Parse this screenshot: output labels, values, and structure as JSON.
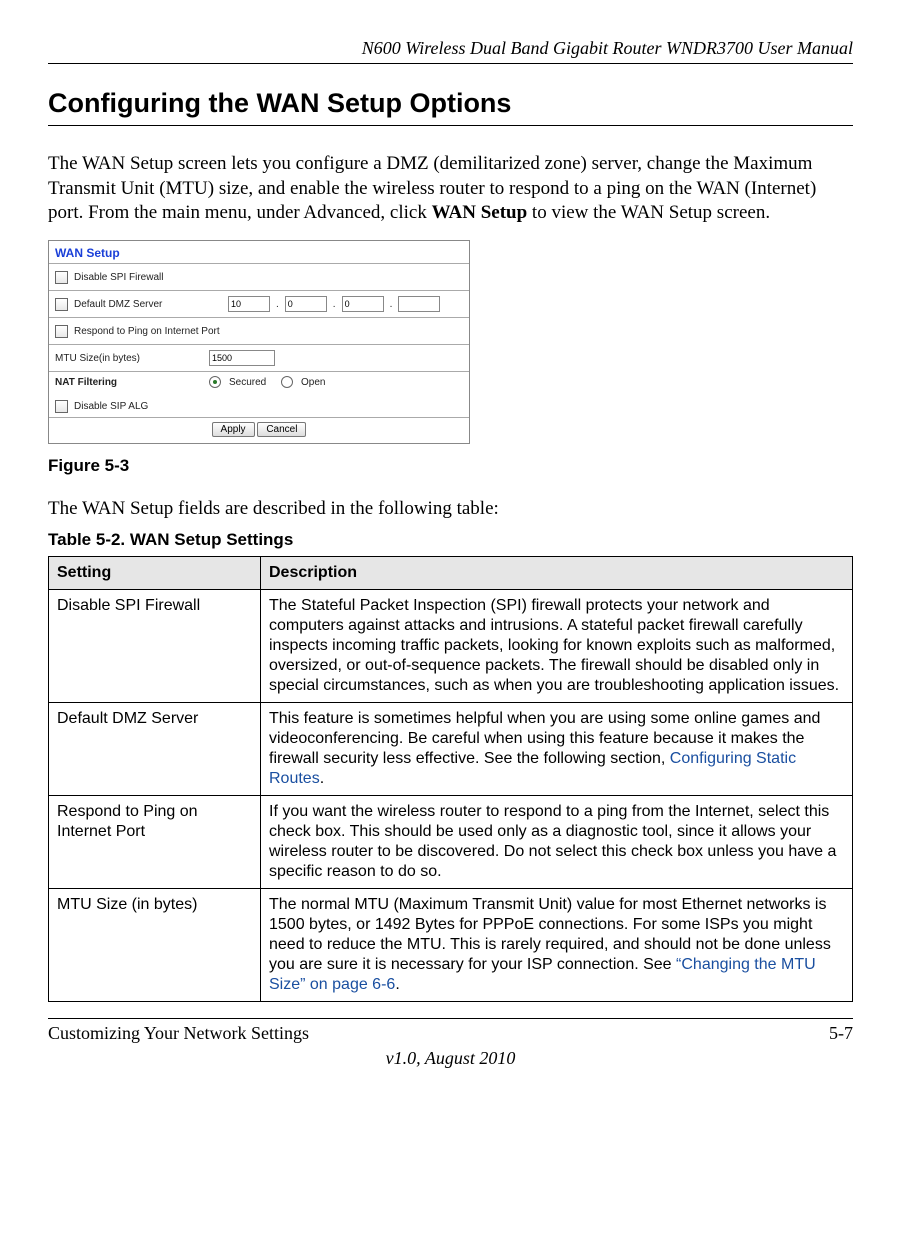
{
  "header": {
    "product_title": "N600 Wireless Dual Band Gigabit Router WNDR3700 User Manual"
  },
  "section": {
    "title": "Configuring the WAN Setup Options",
    "intro_part1": "The WAN Setup screen lets you configure a DMZ (demilitarized zone) server, change the Maximum Transmit Unit (MTU) size, and enable the wireless router to respond to a ping on the WAN (Internet) port. From the main menu, under Advanced, click ",
    "intro_bold": "WAN Setup",
    "intro_part2": " to view the WAN Setup screen."
  },
  "wan_panel": {
    "title": "WAN Setup",
    "rows": {
      "disable_spi": "Disable SPI Firewall",
      "dmz": "Default DMZ Server",
      "dmz_ip": [
        "10",
        "0",
        "0",
        ""
      ],
      "respond_ping": "Respond to Ping on Internet Port",
      "mtu_label": "MTU Size(in bytes)",
      "mtu_value": "1500",
      "nat_label": "NAT Filtering",
      "nat_secured": "Secured",
      "nat_open": "Open",
      "disable_sip": "Disable SIP ALG",
      "apply": "Apply",
      "cancel": "Cancel"
    }
  },
  "figure": {
    "caption": "Figure 5-3"
  },
  "lead_in": "The WAN Setup fields are described in the following table:",
  "table": {
    "caption": "Table 5-2.  WAN Setup Settings",
    "headers": {
      "setting": "Setting",
      "description": "Description"
    },
    "rows": [
      {
        "setting": "Disable SPI Firewall",
        "desc": "The Stateful Packet Inspection (SPI) firewall protects your network and computers against attacks and intrusions. A stateful packet firewall carefully inspects incoming traffic packets, looking for known exploits such as malformed, oversized, or out-of-sequence packets. The firewall should be disabled only in special circumstances, such as when you are troubleshooting application issues."
      },
      {
        "setting": "Default DMZ Server",
        "desc_pre": "This feature is sometimes helpful when you are using some online games and videoconferencing. Be careful when using this feature because it makes the firewall security less effective. See the following section, ",
        "desc_link": "Configuring Static Routes",
        "desc_post": "."
      },
      {
        "setting": "Respond to Ping on Internet Port",
        "desc": "If you want the wireless router to respond to a ping from the Internet, select this check box. This should be used only as a diagnostic tool, since it allows your wireless router to be discovered. Do not select this check box unless you have a specific reason to do so."
      },
      {
        "setting": "MTU Size (in bytes)",
        "desc_pre": "The normal MTU (Maximum Transmit Unit) value for most Ethernet networks is 1500 bytes, or 1492 Bytes for PPPoE connections. For some ISPs you might need to reduce the MTU. This is rarely required, and should not be done unless you are sure it is necessary for your ISP connection. See ",
        "desc_link": "“Changing the MTU Size” on page 6-6",
        "desc_post": "."
      }
    ]
  },
  "footer": {
    "chapter": "Customizing Your Network Settings",
    "page": "5-7",
    "version": "v1.0, August 2010"
  }
}
